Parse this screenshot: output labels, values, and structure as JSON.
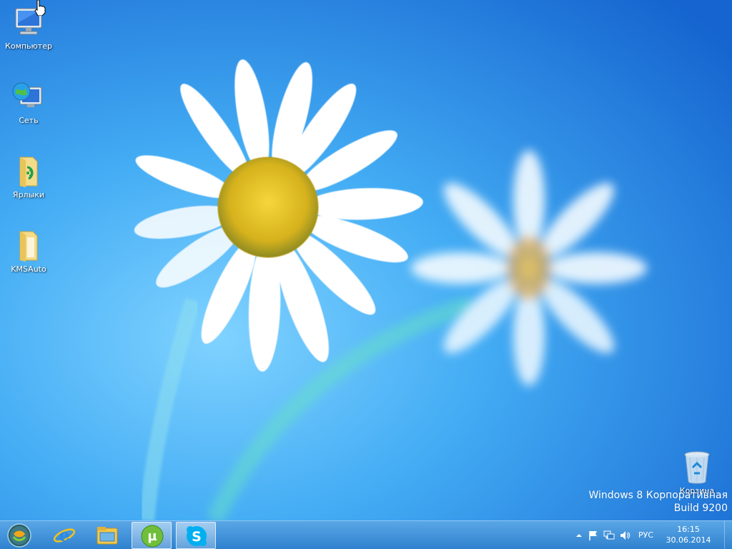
{
  "desktop": {
    "icons": [
      {
        "label": "Компьютер",
        "icon": "computer-icon"
      },
      {
        "label": "Сеть",
        "icon": "network-icon"
      },
      {
        "label": "Ярлыки",
        "icon": "folder-shortcuts-icon"
      },
      {
        "label": "KMSAuto",
        "icon": "folder-icon"
      }
    ],
    "recycle_bin": {
      "label": "Корзина",
      "icon": "recycle-bin-icon"
    },
    "watermark": {
      "line1": "Windows 8 Корпоративная",
      "line2": "Build 9200"
    }
  },
  "taskbar": {
    "buttons": [
      {
        "name": "start-orb",
        "icon": "start-orb-icon",
        "active": false
      },
      {
        "name": "internet-explorer",
        "icon": "internet-explorer-icon",
        "active": false
      },
      {
        "name": "file-explorer",
        "icon": "file-explorer-icon",
        "active": false
      },
      {
        "name": "utorrent",
        "icon": "utorrent-icon",
        "active": true
      },
      {
        "name": "skype",
        "icon": "skype-icon",
        "active": true
      }
    ],
    "tray": {
      "icons": [
        "show-hidden-icons-chevron",
        "action-center-flag-icon",
        "network-status-icon",
        "volume-icon"
      ],
      "language": "РУС",
      "time": "16:15",
      "date": "30.06.2014"
    }
  },
  "colors": {
    "background": "#3fa9f5",
    "taskbar": "#3f8fd8",
    "text": "#ffffff"
  }
}
